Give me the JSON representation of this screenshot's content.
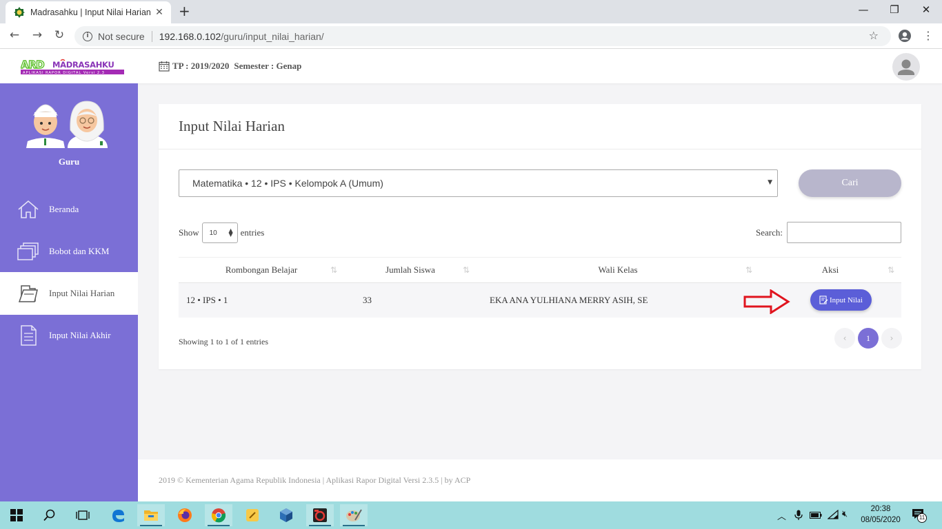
{
  "browser": {
    "tab_title": "Madrasahku | Input Nilai Harian | Madrasahku",
    "tab_close": "✕",
    "new_tab": "+",
    "minimize": "—",
    "restore": "❐",
    "close": "✕",
    "security_label": "Not secure",
    "url_host": "192.168.0.102",
    "url_path": "/guru/input_nilai_harian/",
    "bookmark_icon": "star-icon",
    "menu_icon": "⋮"
  },
  "header": {
    "logo_text": "ARD MADRASAHKU",
    "logo_subtext": "APLIKASI RAPOR DIGITAL Versi 2.3",
    "tp_label": "TP : 2019/2020",
    "semester_label": "Semester : Genap"
  },
  "sidebar": {
    "role": "Guru",
    "items": [
      {
        "label": "Beranda",
        "icon": "home-icon",
        "active": false
      },
      {
        "label": "Bobot dan KKM",
        "icon": "layers-icon",
        "active": false
      },
      {
        "label": "Input Nilai Harian",
        "icon": "folder-icon",
        "active": true
      },
      {
        "label": "Input Nilai Akhir",
        "icon": "document-icon",
        "active": false
      }
    ]
  },
  "main": {
    "title": "Input Nilai Harian",
    "mapel_selected": "Matematika • 12 • IPS • Kelompok A (Umum)",
    "cari_label": "Cari",
    "show_label": "Show",
    "entries_value": "10",
    "entries_label": "entries",
    "search_label": "Search:",
    "search_value": "",
    "table": {
      "columns": [
        "Rombongan Belajar",
        "Jumlah Siswa",
        "Wali Kelas",
        "Aksi"
      ],
      "rows": [
        {
          "rombel": "12 • IPS • 1",
          "jumlah": "33",
          "wali": "EKA ANA YULHIANA MERRY ASIH, SE",
          "aksi_label": "Input Nilai"
        }
      ]
    },
    "showing_text": "Showing 1 to 1 of 1 entries",
    "pagination": {
      "prev": "‹",
      "current": "1",
      "next": "›"
    }
  },
  "footer": {
    "text": "2019 © Kementerian Agama Republik Indonesia | Aplikasi Rapor Digital Versi 2.3.5 | by ACP"
  },
  "taskbar": {
    "time": "20:38",
    "date": "08/05/2020",
    "notification_count": "11"
  },
  "colors": {
    "sidebar": "#7b6fd6",
    "primary_button": "#5b5ed8",
    "cari_button": "#b8b6cc",
    "annotation_arrow": "#e0141e",
    "taskbar": "#9fdcdf"
  }
}
